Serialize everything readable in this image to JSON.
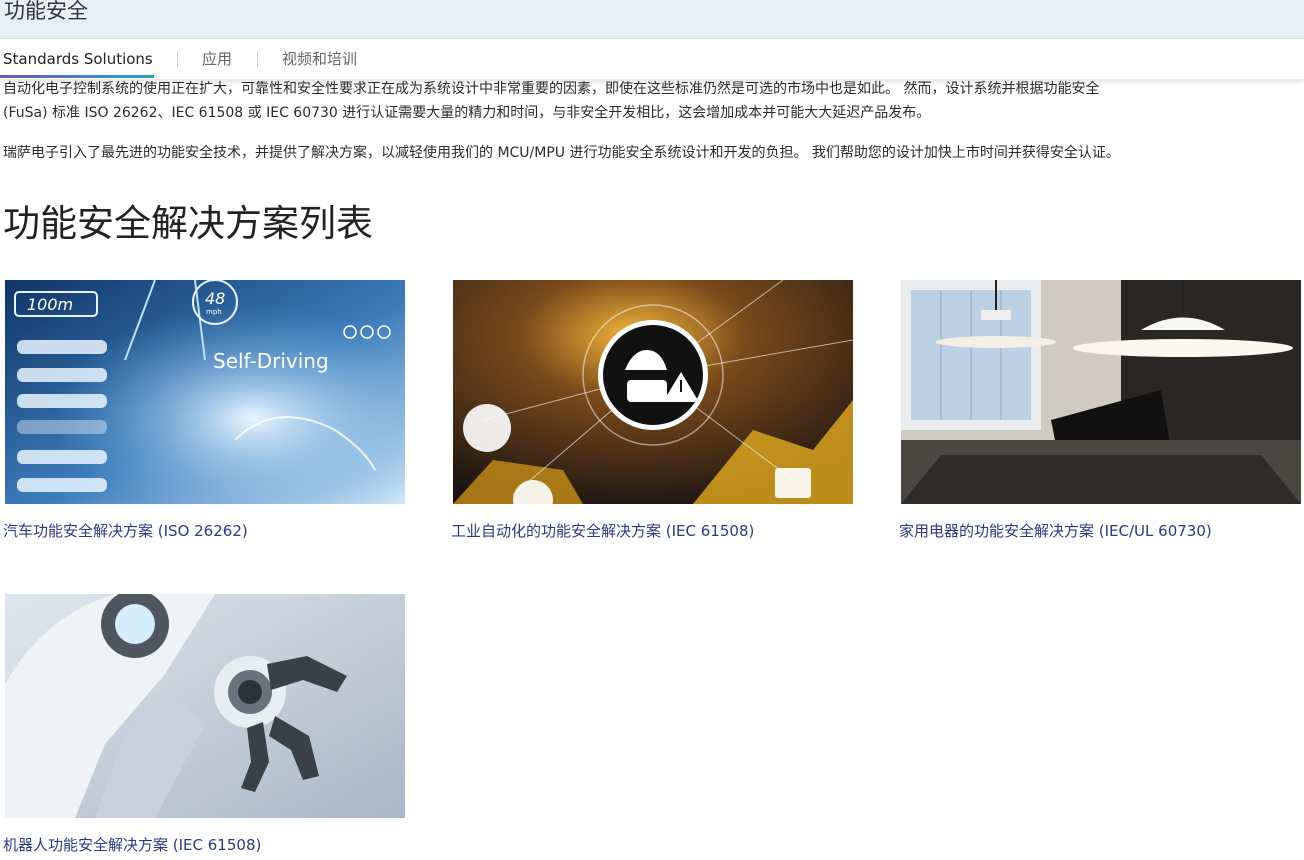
{
  "header": {
    "title": "功能安全"
  },
  "subnav": {
    "items": [
      {
        "label": "Standards Solutions",
        "active": true
      },
      {
        "label": "应用",
        "active": false
      },
      {
        "label": "视频和培训",
        "active": false
      }
    ]
  },
  "intro": {
    "p1_line1": "自动化电子控制系统的使用正在扩大，可靠性和安全性要求正在成为系统设计中非常重要的因素，即使在这些标准仍然是可选的市场中也是如此。 然而，设计系统并根据功能安全",
    "p1_line2": "(FuSa) 标准 ISO 26262、IEC 61508 或 IEC 60730 进行认证需要大量的精力和时间，与非安全开发相比，这会增加成本并可能大大延迟产品发布。",
    "p2": "瑞萨电子引入了最先进的功能安全技术，并提供了解决方案，以减轻使用我们的 MCU/MPU 进行功能安全系统设计和开发的负担。 我们帮助您的设计加快上市时间并获得安全认证。"
  },
  "solutions": {
    "title": "功能安全解决方案列表",
    "cards": [
      {
        "label": "汽车功能安全解决方案 (ISO 26262)",
        "image_text": {
          "distance": "100m",
          "speed": "48",
          "speed_unit": "mph",
          "caption": "Self-Driving"
        }
      },
      {
        "label": "工业自动化的功能安全解决方案 (IEC 61508)"
      },
      {
        "label": "家用电器的功能安全解决方案 (IEC/UL 60730)"
      },
      {
        "label": "机器人功能安全解决方案 (IEC 61508)"
      }
    ]
  },
  "colors": {
    "link": "#2a3a80",
    "header_bg": "#e8eff8",
    "accent_start": "#6a5bb4",
    "accent_end": "#26a0c9"
  }
}
